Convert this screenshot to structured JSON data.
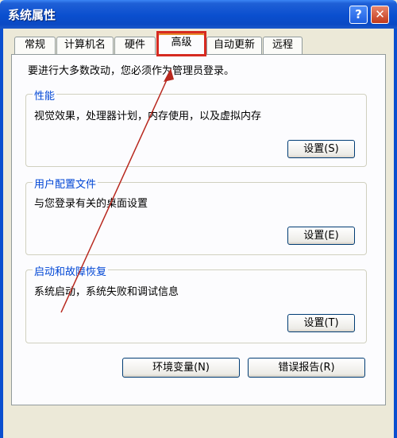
{
  "window": {
    "title": "系统属性"
  },
  "titlebar": {
    "help_glyph": "?",
    "close_glyph": "✕"
  },
  "tabs": [
    {
      "label": "常规"
    },
    {
      "label": "计算机名"
    },
    {
      "label": "硬件"
    },
    {
      "label": "高级",
      "active": true
    },
    {
      "label": "自动更新"
    },
    {
      "label": "远程"
    }
  ],
  "notice": "要进行大多数改动，您必须作为管理员登录。",
  "groups": {
    "performance": {
      "title": "性能",
      "desc": "视觉效果，处理器计划，内存使用，以及虚拟内存",
      "button": "设置(S)"
    },
    "profiles": {
      "title": "用户配置文件",
      "desc": "与您登录有关的桌面设置",
      "button": "设置(E)"
    },
    "startup": {
      "title": "启动和故障恢复",
      "desc": "系统启动，系统失败和调试信息",
      "button": "设置(T)"
    }
  },
  "bottom_buttons": {
    "env": "环境变量(N)",
    "error": "错误报告(R)"
  },
  "colors": {
    "accent": "#d62a20",
    "titlebar": "#0a4fcf",
    "group_title": "#0046d5"
  }
}
